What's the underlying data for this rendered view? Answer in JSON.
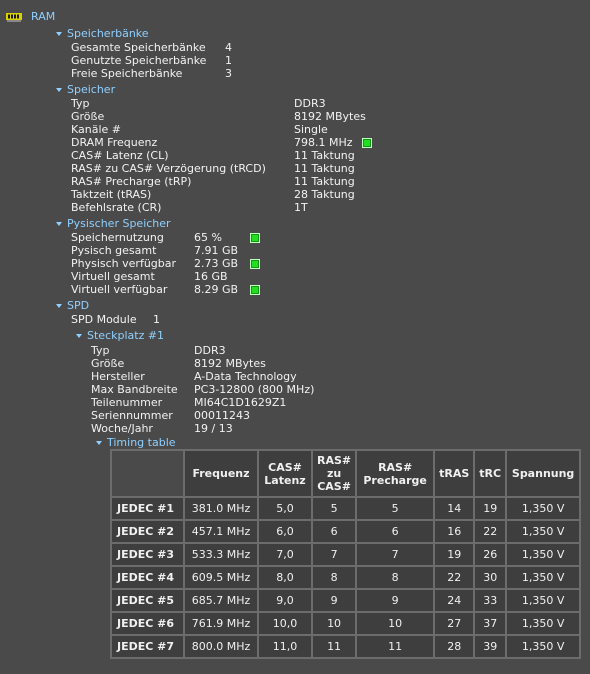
{
  "root": {
    "label": "RAM"
  },
  "bank": {
    "title": "Speicherbänke",
    "rows": [
      {
        "label": "Gesamte Speicherbänke",
        "value": "4"
      },
      {
        "label": "Genutzte Speicherbänke",
        "value": "1"
      },
      {
        "label": "Freie Speicherbänke",
        "value": "3"
      }
    ]
  },
  "mem": {
    "title": "Speicher",
    "rows": [
      {
        "label": "Typ",
        "value": "DDR3"
      },
      {
        "label": "Größe",
        "value": "8192 MBytes"
      },
      {
        "label": "Kanäle #",
        "value": "Single"
      },
      {
        "label": "DRAM Frequenz",
        "value": "798.1 MHz"
      },
      {
        "label": "CAS# Latenz (CL)",
        "value": "11 Taktung"
      },
      {
        "label": "RAS# zu CAS# Verzögerung (tRCD)",
        "value": "11 Taktung"
      },
      {
        "label": "RAS# Precharge (tRP)",
        "value": "11 Taktung"
      },
      {
        "label": "Taktzeit (tRAS)",
        "value": "28 Taktung"
      },
      {
        "label": "Befehlsrate (CR)",
        "value": "1T"
      }
    ]
  },
  "phys": {
    "title": "Pysischer Speicher",
    "rows": [
      {
        "label": "Speichernutzung",
        "value": "65 %"
      },
      {
        "label": "Pysisch gesamt",
        "value": "7.91 GB"
      },
      {
        "label": "Physisch verfügbar",
        "value": "2.73 GB"
      },
      {
        "label": "Virtuell gesamt",
        "value": "16 GB"
      },
      {
        "label": "Virtuell verfügbar",
        "value": "8.29 GB"
      }
    ]
  },
  "spd": {
    "title": "SPD",
    "modules_label": "SPD Module",
    "modules_value": "1",
    "slot": {
      "title": "Steckplatz #1",
      "rows": [
        {
          "label": "Typ",
          "value": "DDR3"
        },
        {
          "label": "Größe",
          "value": "8192 MBytes"
        },
        {
          "label": "Hersteller",
          "value": "A-Data Technology"
        },
        {
          "label": "Max Bandbreite",
          "value": "PC3-12800 (800 MHz)"
        },
        {
          "label": "Teilenummer",
          "value": "MI64C1D1629Z1"
        },
        {
          "label": "Seriennummer",
          "value": "00011243"
        },
        {
          "label": "Woche/Jahr",
          "value": "19 / 13"
        }
      ],
      "timing": {
        "title": "Timing table",
        "headers": [
          "Frequenz",
          "CAS#\nLatenz",
          "RAS#\nzu\nCAS#",
          "RAS#\nPrecharge",
          "tRAS",
          "tRC",
          "Spannung"
        ],
        "rows": [
          {
            "name": "JEDEC #1",
            "cells": [
              "381.0 MHz",
              "5,0",
              "5",
              "5",
              "14",
              "19",
              "1,350 V"
            ]
          },
          {
            "name": "JEDEC #2",
            "cells": [
              "457.1 MHz",
              "6,0",
              "6",
              "6",
              "16",
              "22",
              "1,350 V"
            ]
          },
          {
            "name": "JEDEC #3",
            "cells": [
              "533.3 MHz",
              "7,0",
              "7",
              "7",
              "19",
              "26",
              "1,350 V"
            ]
          },
          {
            "name": "JEDEC #4",
            "cells": [
              "609.5 MHz",
              "8,0",
              "8",
              "8",
              "22",
              "30",
              "1,350 V"
            ]
          },
          {
            "name": "JEDEC #5",
            "cells": [
              "685.7 MHz",
              "9,0",
              "9",
              "9",
              "24",
              "33",
              "1,350 V"
            ]
          },
          {
            "name": "JEDEC #6",
            "cells": [
              "761.9 MHz",
              "10,0",
              "10",
              "10",
              "27",
              "37",
              "1,350 V"
            ]
          },
          {
            "name": "JEDEC #7",
            "cells": [
              "800.0 MHz",
              "11,0",
              "11",
              "11",
              "28",
              "39",
              "1,350 V"
            ]
          }
        ]
      }
    }
  }
}
